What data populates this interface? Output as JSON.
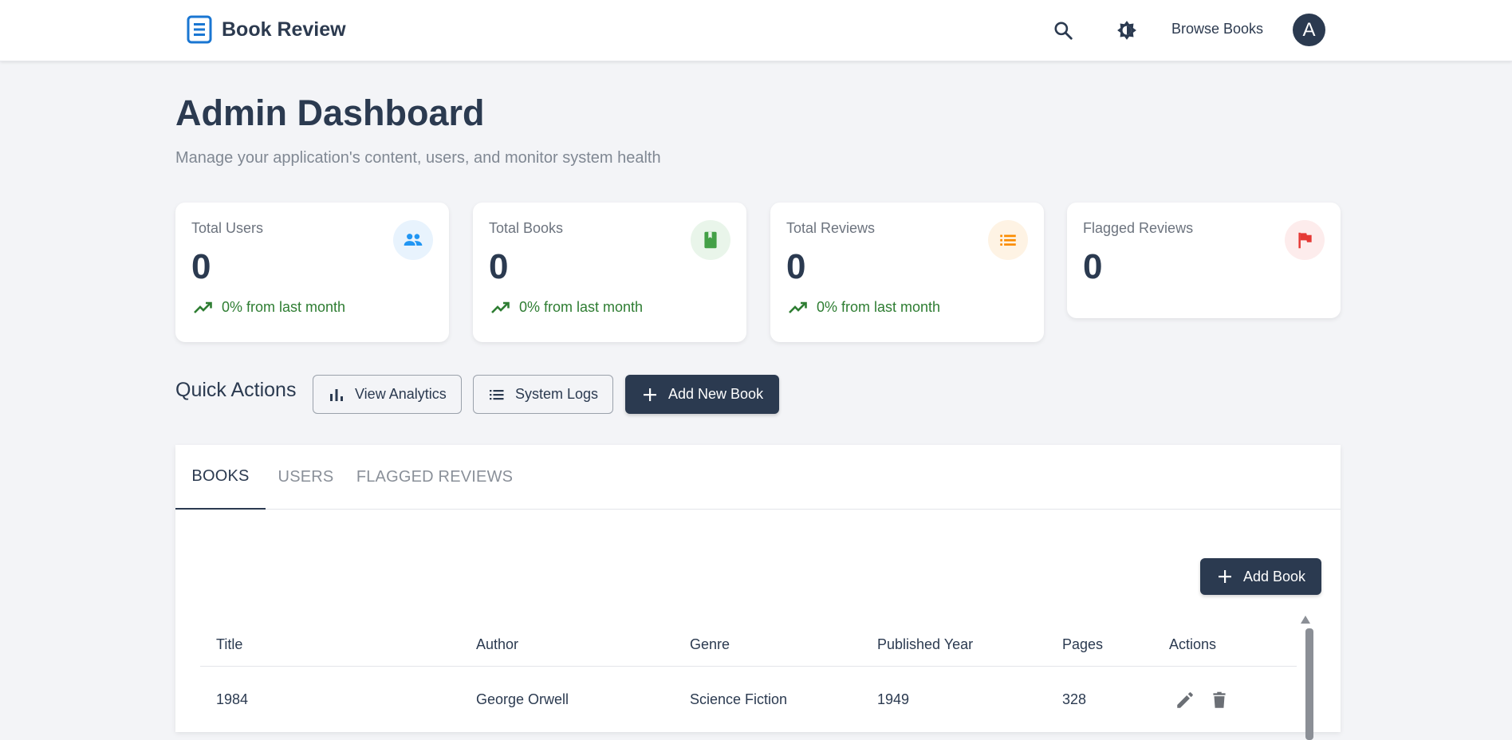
{
  "app": {
    "name": "Book Review",
    "nav_browse": "Browse Books",
    "avatar_initial": "A"
  },
  "header": {
    "title": "Admin Dashboard",
    "subtitle": "Manage your application's content, users, and monitor system health"
  },
  "stats": [
    {
      "label": "Total Users",
      "value": "0",
      "trend": "0% from last month",
      "icon": "people-icon",
      "color": "#2196f3"
    },
    {
      "label": "Total Books",
      "value": "0",
      "trend": "0% from last month",
      "icon": "book-icon",
      "color": "#43a047"
    },
    {
      "label": "Total Reviews",
      "value": "0",
      "trend": "0% from last month",
      "icon": "list-icon",
      "color": "#fb8c00"
    },
    {
      "label": "Flagged Reviews",
      "value": "0",
      "icon": "flag-icon",
      "color": "#e53935"
    }
  ],
  "quick_actions": {
    "title": "Quick Actions",
    "view_analytics": "View Analytics",
    "system_logs": "System Logs",
    "add_new_book": "Add New Book"
  },
  "tabs": [
    {
      "label": "BOOKS",
      "active": true
    },
    {
      "label": "USERS",
      "active": false
    },
    {
      "label": "FLAGGED REVIEWS",
      "active": false
    }
  ],
  "books": {
    "add_button": "Add Book",
    "columns": [
      "Title",
      "Author",
      "Genre",
      "Published Year",
      "Pages",
      "Actions"
    ],
    "rows": [
      {
        "title": "1984",
        "author": "George Orwell",
        "genre": "Science Fiction",
        "year": "1949",
        "pages": "328"
      }
    ]
  },
  "colors": {
    "primary_dark": "#2b3a50",
    "trend_green": "#2e7d32",
    "page_bg": "#f3f4f7",
    "brand_icon": "#1976d2"
  }
}
